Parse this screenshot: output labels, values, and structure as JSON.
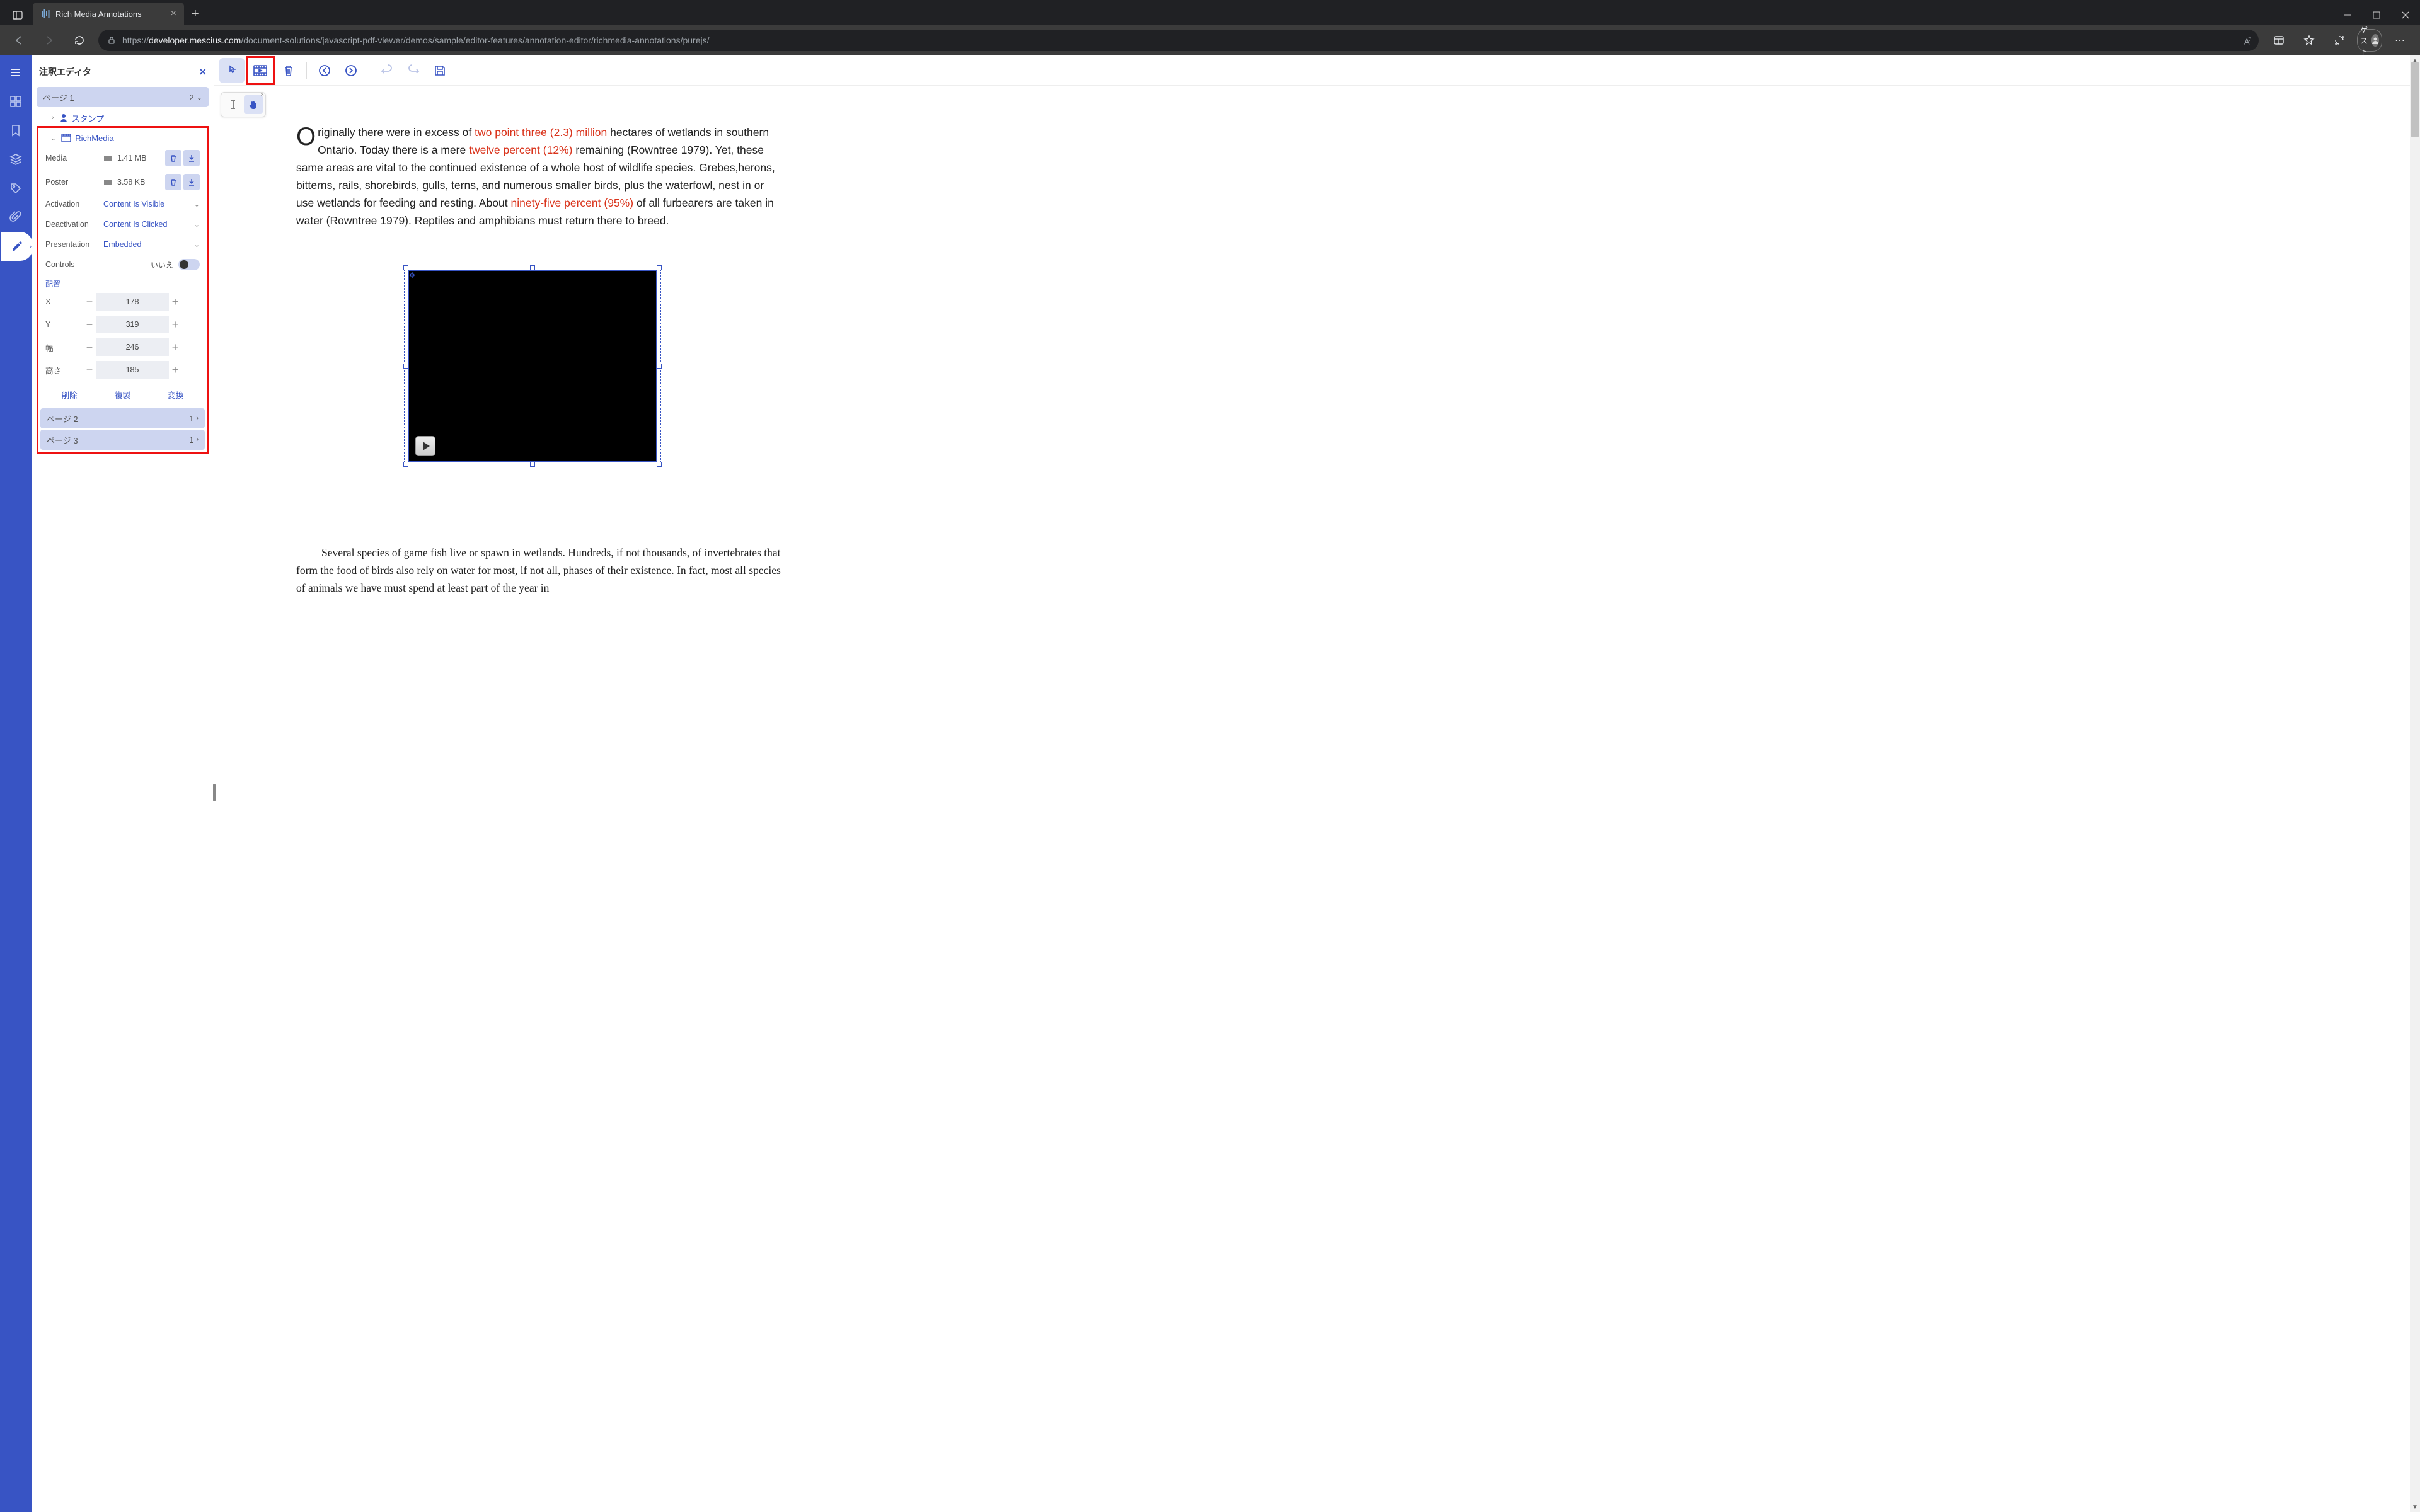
{
  "browser": {
    "tab_title": "Rich Media Annotations",
    "url_prefix": "https://",
    "url_domain": "developer.mescius.com",
    "url_path": "/document-solutions/javascript-pdf-viewer/demos/sample/editor-features/annotation-editor/richmedia-annotations/purejs/",
    "guest_label": "ゲスト"
  },
  "panel": {
    "title": "注釈エディタ",
    "page1_label": "ページ 1",
    "page1_count": "2",
    "stamp_label": "スタンプ",
    "richmedia_label": "RichMedia",
    "props": {
      "media_label": "Media",
      "media_size": "1.41 MB",
      "poster_label": "Poster",
      "poster_size": "3.58 KB",
      "activation_label": "Activation",
      "activation_value": "Content Is Visible",
      "deactivation_label": "Deactivation",
      "deactivation_value": "Content Is Clicked",
      "presentation_label": "Presentation",
      "presentation_value": "Embedded",
      "controls_label": "Controls",
      "controls_value": "いいえ"
    },
    "placement_label": "配置",
    "coords": {
      "x_label": "X",
      "x_value": "178",
      "y_label": "Y",
      "y_value": "319",
      "w_label": "幅",
      "w_value": "246",
      "h_label": "高さ",
      "h_value": "185"
    },
    "actions": {
      "delete": "削除",
      "duplicate": "複製",
      "convert": "変換"
    },
    "page2_label": "ページ 2",
    "page2_count": "1",
    "page3_label": "ページ 3",
    "page3_count": "1"
  },
  "doc": {
    "p1_a": "riginally there were in excess of ",
    "p1_h1": "two point three (2.3) million",
    "p1_b": " hectares of wetlands in southern Ontario. Today there is a mere ",
    "p1_h2": "twelve percent (12%)",
    "p1_c": " remaining (Rowntree 1979). Yet, these same areas are vital to the continued existence of a whole host of wildlife species. Grebes,herons, bitterns, rails, shorebirds, gulls, terns, and numerous smaller birds, plus the waterfowl, nest in or use wetlands for feeding and resting. About ",
    "p1_h3": "ninety-five percent (95%)",
    "p1_d": " of all furbearers are taken in water (Rowntree 1979). Reptiles and amphibians must return there to breed.",
    "p2": "Several species of game fish live or spawn in wetlands. Hundreds, if not thousands, of invertebrates that form the food of birds also rely on water for most, if not all, phases of their existence. In fact, most all species of animals we have must spend at least part of the year in"
  }
}
